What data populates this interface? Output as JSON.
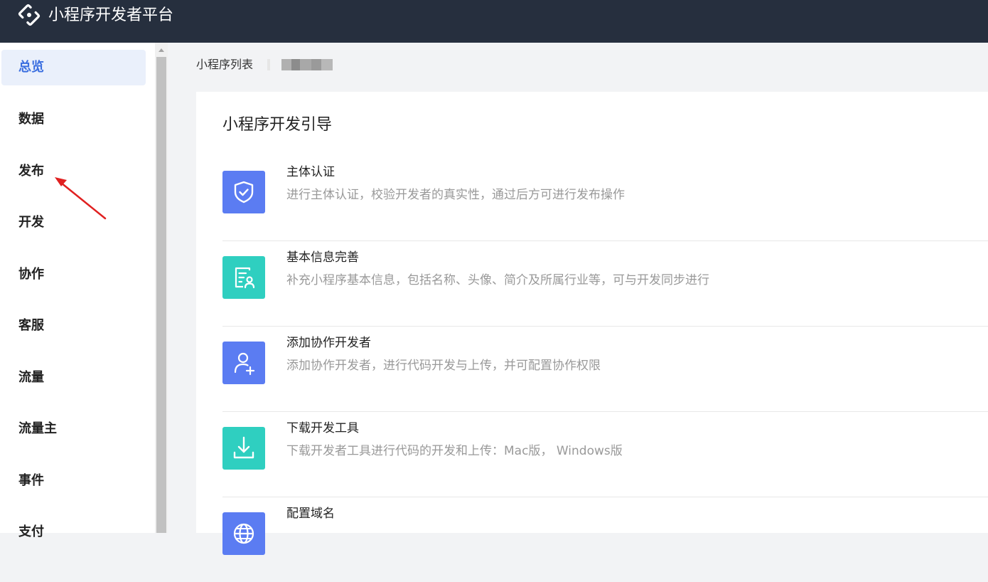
{
  "header": {
    "brand": "小程序开发者平台",
    "logo_icon": "platform-logo-icon"
  },
  "sidebar": {
    "items": [
      {
        "label": "总览",
        "active": true
      },
      {
        "label": "数据",
        "active": false
      },
      {
        "label": "发布",
        "active": false
      },
      {
        "label": "开发",
        "active": false
      },
      {
        "label": "协作",
        "active": false
      },
      {
        "label": "客服",
        "active": false
      },
      {
        "label": "流量",
        "active": false
      },
      {
        "label": "流量主",
        "active": false
      },
      {
        "label": "事件",
        "active": false
      },
      {
        "label": "支付",
        "active": false
      }
    ]
  },
  "breadcrumb": {
    "list_link": "小程序列表"
  },
  "guide": {
    "title": "小程序开发引导",
    "steps": [
      {
        "title": "主体认证",
        "desc": "进行主体认证，校验开发者的真实性，通过后方可进行发布操作",
        "icon": "shield-check-icon",
        "color": "#5b7cf2"
      },
      {
        "title": "基本信息完善",
        "desc": "补充小程序基本信息，包括名称、头像、简介及所属行业等，可与开发同步进行",
        "icon": "profile-card-icon",
        "color": "#2fcfc0"
      },
      {
        "title": "添加协作开发者",
        "desc": "添加协作开发者，进行代码开发与上传，并可配置协作权限",
        "icon": "add-user-icon",
        "color": "#5b7cf2"
      },
      {
        "title": "下载开发工具",
        "desc_prefix": "下载开发者工具进行代码的开发和上传：",
        "mac_link": "Mac版",
        "separator": "，",
        "windows_link": "Windows版",
        "icon": "download-icon",
        "color": "#2fcfc0"
      },
      {
        "title": "配置域名",
        "icon": "globe-icon",
        "color": "#5b7cf2"
      }
    ]
  },
  "annotation": {
    "arrow_color": "#e02020"
  }
}
